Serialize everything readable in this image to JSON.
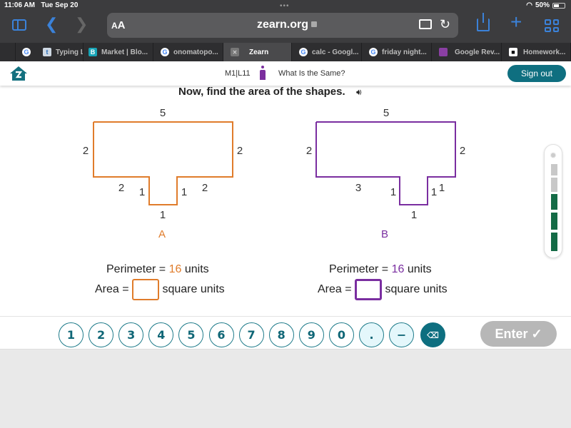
{
  "status_bar": {
    "time": "11:06 AM",
    "date": "Tue Sep 20",
    "battery": "50%"
  },
  "browser": {
    "text_size_label_small": "A",
    "text_size_label_large": "A",
    "url": "zearn.org",
    "icons": [
      "sidebar-icon",
      "back-icon",
      "forward-icon",
      "lock-icon",
      "extension-icon",
      "reload-icon",
      "share-icon",
      "new-tab-icon",
      "tab-overview-icon"
    ]
  },
  "tabs": [
    {
      "label": "",
      "icon": "google",
      "icon_glyph": "G"
    },
    {
      "label": "Typing L",
      "icon": "t",
      "icon_glyph": "t"
    },
    {
      "label": "Market | Blo...",
      "icon": "b",
      "icon_glyph": "B"
    },
    {
      "label": "onomatopo...",
      "icon": "google",
      "icon_glyph": "G"
    },
    {
      "label": "Zearn",
      "icon": "close",
      "icon_glyph": "✕",
      "active": true
    },
    {
      "label": "calc - Googl...",
      "icon": "google",
      "icon_glyph": "G"
    },
    {
      "label": "friday night...",
      "icon": "google",
      "icon_glyph": "G"
    },
    {
      "label": "Google Rev...",
      "icon": "review",
      "icon_glyph": ""
    },
    {
      "label": "Homework...",
      "icon": "homework",
      "icon_glyph": "■"
    }
  ],
  "header": {
    "lesson_code": "M1|L11",
    "lesson_title": "What Is the Same?",
    "sign_out_label": "Sign out"
  },
  "problem": {
    "prompt": "Now, find the area of the shapes.",
    "speaker_glyph": "🔊",
    "shapes": [
      {
        "name": "A",
        "color": "#e07c2b",
        "labels": {
          "top": "5",
          "left": "2",
          "right": "2",
          "bottom_left": "2",
          "notch_left": "1",
          "notch_right": "1",
          "bottom_right": "2",
          "notch_bottom": "1"
        },
        "perimeter_prefix": "Perimeter = ",
        "perimeter_value": "16",
        "perimeter_suffix": " units",
        "area_prefix": "Area = ",
        "area_value": "",
        "area_suffix": " square units"
      },
      {
        "name": "B",
        "color": "#7a2ea0",
        "labels": {
          "top": "5",
          "left": "2",
          "right": "2",
          "bottom_left": "3",
          "notch_left": "1",
          "notch_right": "1",
          "bottom_right": "1",
          "notch_bottom": "1"
        },
        "perimeter_prefix": "Perimeter = ",
        "perimeter_value": "16",
        "perimeter_suffix": " units",
        "area_prefix": "Area = ",
        "area_value": "",
        "area_suffix": " square units"
      }
    ]
  },
  "progress": {
    "completed_segments": 3,
    "total_segments": 5
  },
  "keypad": {
    "keys": [
      "1",
      "2",
      "3",
      "4",
      "5",
      "6",
      "7",
      "8",
      "9",
      "0",
      ".",
      "−"
    ],
    "delete_glyph": "⌫",
    "enter_label": "Enter ✓"
  },
  "colors": {
    "accent": "#0f6f80",
    "shape_a": "#e07c2b",
    "shape_b": "#7a2ea0",
    "progress_done": "#146b46",
    "progress_todo": "#c8c8c8"
  }
}
